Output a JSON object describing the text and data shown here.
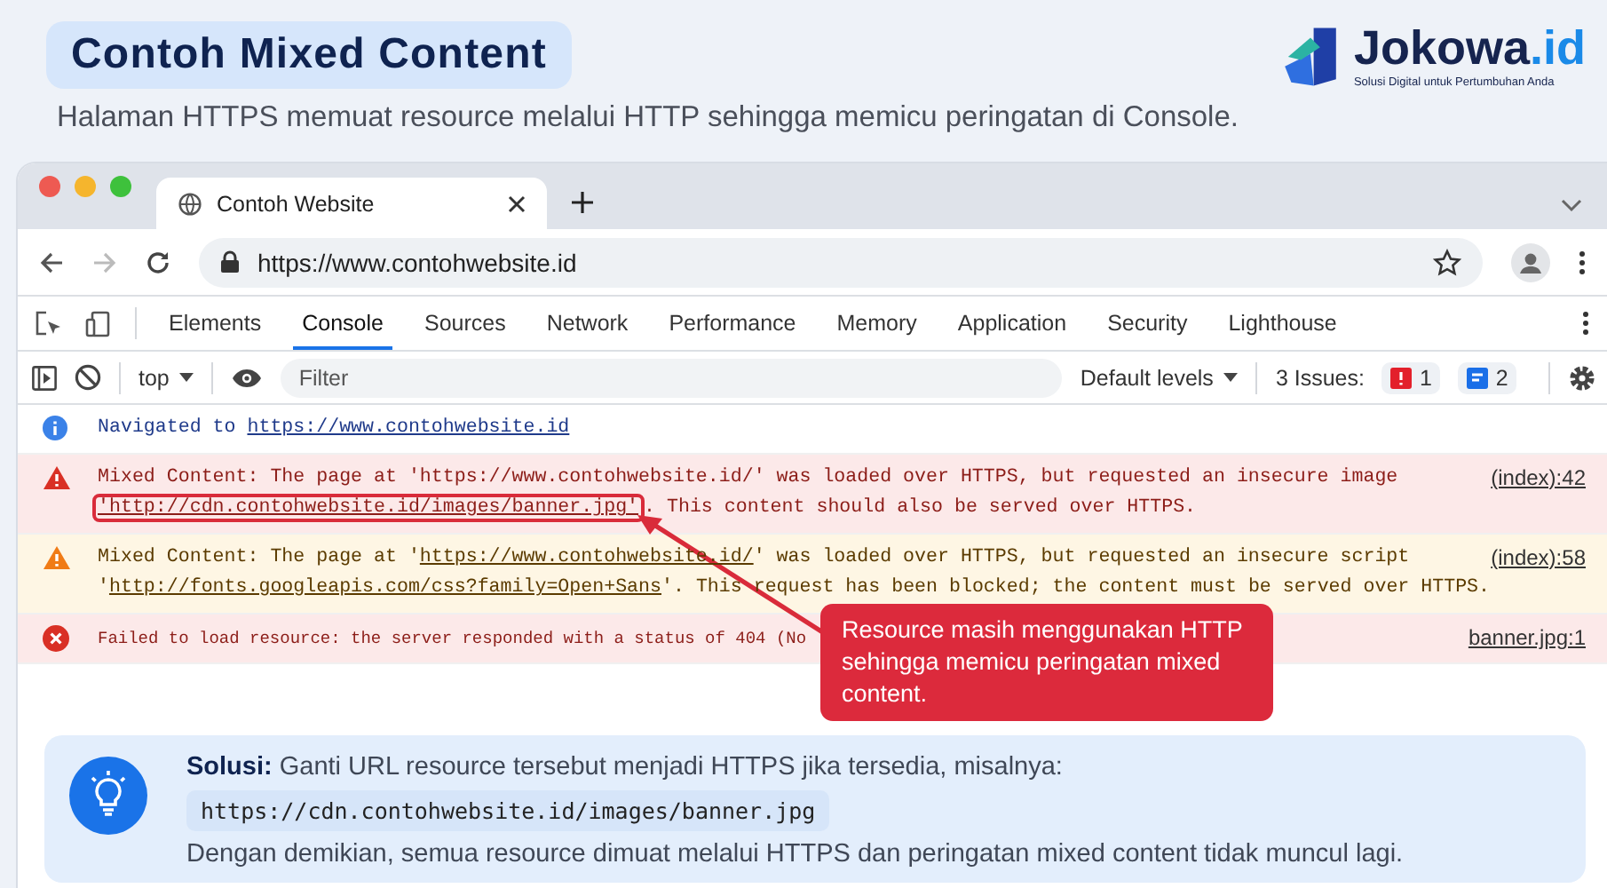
{
  "header": {
    "title": "Contoh Mixed Content",
    "subtitle": "Halaman HTTPS memuat resource melalui HTTP sehingga memicu peringatan di Console."
  },
  "logo": {
    "name": "Jokowa",
    "suffix": ".id",
    "tagline": "Solusi Digital untuk Pertumbuhan Anda"
  },
  "browser": {
    "tab_title": "Contoh Website",
    "url": "https://www.contohwebsite.id"
  },
  "devtools": {
    "tabs": [
      {
        "label": "Elements",
        "selected": false
      },
      {
        "label": "Console",
        "selected": true
      },
      {
        "label": "Sources",
        "selected": false
      },
      {
        "label": "Network",
        "selected": false
      },
      {
        "label": "Performance",
        "selected": false
      },
      {
        "label": "Memory",
        "selected": false
      },
      {
        "label": "Application",
        "selected": false
      },
      {
        "label": "Security",
        "selected": false
      },
      {
        "label": "Lighthouse",
        "selected": false
      }
    ],
    "context": "top",
    "filter_placeholder": "Filter",
    "levels": "Default levels",
    "issues_label": "3 Issues:",
    "issues_errors": "1",
    "issues_info": "2"
  },
  "console": [
    {
      "kind": "info",
      "lines": [
        [
          {
            "text": "Navigated to ",
            "kind": "plain"
          },
          {
            "text": "https://www.contohwebsite.id",
            "kind": "link"
          }
        ]
      ]
    },
    {
      "kind": "error",
      "source": "(index):42",
      "lines": [
        [
          {
            "text": "Mixed Content: The page at 'https://www.contohwebsite.id/' was loaded over HTTPS, but requested an insecure image",
            "kind": "plain"
          }
        ],
        [
          {
            "text": "'http://cdn.contohwebsite.id/images/banner.jpg'",
            "kind": "highlight"
          },
          {
            "text": ". This content should also be served over HTTPS.",
            "kind": "plain"
          }
        ]
      ]
    },
    {
      "kind": "warning",
      "source": "(index):58",
      "lines": [
        [
          {
            "text": "Mixed Content: The page at '",
            "kind": "plain"
          },
          {
            "text": "https://www.contohwebsite.id/",
            "kind": "link"
          },
          {
            "text": "' was loaded over HTTPS, but requested an insecure script",
            "kind": "plain"
          }
        ],
        [
          {
            "text": "'",
            "kind": "plain"
          },
          {
            "text": "http://fonts.googleapis.com/css?family=Open+Sans",
            "kind": "link"
          },
          {
            "text": "'. This request has been blocked; the content must be served over HTTPS.",
            "kind": "plain"
          }
        ]
      ]
    },
    {
      "kind": "error",
      "source": "banner.jpg:1",
      "lines": [
        [
          {
            "text": "Failed to load resource: the server responded with a status of 404 (No",
            "kind": "plain"
          }
        ]
      ]
    }
  ],
  "callout": "Resource masih menggunakan HTTP sehingga memicu peringatan mixed content.",
  "solution": {
    "lead": "**Solusi:** Ganti URL resource tersebut menjadi HTTPS jika tersedia, misalnya:",
    "code": "https://cdn.contohwebsite.id/images/banner.jpg",
    "note": "Dengan demikian, semua resource dimuat melalui HTTPS dan peringatan mixed content tidak muncul lagi."
  }
}
